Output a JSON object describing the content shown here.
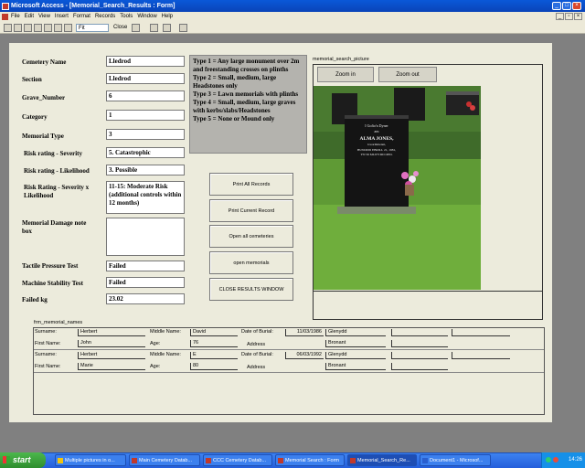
{
  "window": {
    "title": "Microsoft Access - [Memorial_Search_Results : Form]"
  },
  "menu": [
    "File",
    "Edit",
    "View",
    "Insert",
    "Format",
    "Records",
    "Tools",
    "Window",
    "Help"
  ],
  "toolbar": {
    "font_value": "Fit",
    "close_label": "Close"
  },
  "fields": [
    {
      "label": "Cemetery Name",
      "value": "Lledrod"
    },
    {
      "label": "Section",
      "value": "Lledrod"
    },
    {
      "label": "Grave_Number",
      "value": "6"
    },
    {
      "label": "Category",
      "value": "1"
    },
    {
      "label": "Memorial Type",
      "value": "3"
    },
    {
      "label": "Risk rating - Severity",
      "value": "5. Catastrophic"
    },
    {
      "label": "Risk rating - Likelihood",
      "value": "3. Possible"
    },
    {
      "label": "Risk Rating - Severity x Likelihood",
      "value": "11-15: Moderate Risk (additional controls within 12 months)"
    },
    {
      "label": "Memorial Damage note box",
      "value": ""
    },
    {
      "label": "Tactile Pressure Test",
      "value": "Failed"
    },
    {
      "label": "Machine Stability Test",
      "value": "Failed"
    },
    {
      "label": "Failed kg",
      "value": "23.02"
    }
  ],
  "type_notes": "Type 1 = Any large monument over 2m and freestanding crosses on plinths\nType 2 = Small, medium, large Headstones only\nType 3 = Lawn memorials with plinths\nType 4 = Small, medium, large graves with kerbs/slabs/Headstones\nType 5 = None or Mound only",
  "buttons": [
    "Print All Records",
    "Print Current Record",
    "Open all cemeteries",
    "open memorials",
    "CLOSE RESULTS WINDOW"
  ],
  "picture": {
    "label": "memorial_search_picture",
    "zoom_in": "Zoom in",
    "zoom_out": "Zoom out",
    "headstone_text": [
      "I Gofio'n Dyner",
      "am",
      "ALMA JONES,",
      "Gwarthmenni,",
      "HUNODD EBRILL 21, 1981,",
      "YN 56 MLWYDD OED."
    ]
  },
  "subform": {
    "label": "frm_memorial_names",
    "labels": {
      "surname": "Surname:",
      "first_name": "First Name:",
      "middle_name": "Middle Name:",
      "age": "Age:",
      "date_of_burial": "Date of Burial:",
      "address": "Address"
    },
    "records": [
      {
        "surname": "Herbert",
        "first_name": "John",
        "middle_name": "David",
        "age": "76",
        "date_of_burial": "11/03/1986",
        "address1": "Glenydd",
        "address2": "Bronant"
      },
      {
        "surname": "Herbert",
        "first_name": "Marie",
        "middle_name": "E",
        "age": "80",
        "date_of_burial": "06/03/1992",
        "address1": "Glenydd",
        "address2": "Bronant"
      }
    ]
  },
  "taskbar": {
    "start": "start",
    "tasks": [
      "Multiple pictures in o...",
      "Main Cemetery Datab...",
      "CCC Cemetery Datab...",
      "Memorial Search : Form",
      "Memorial_Search_Re...",
      "Document1 - Microsof..."
    ],
    "clock": "14:26"
  }
}
